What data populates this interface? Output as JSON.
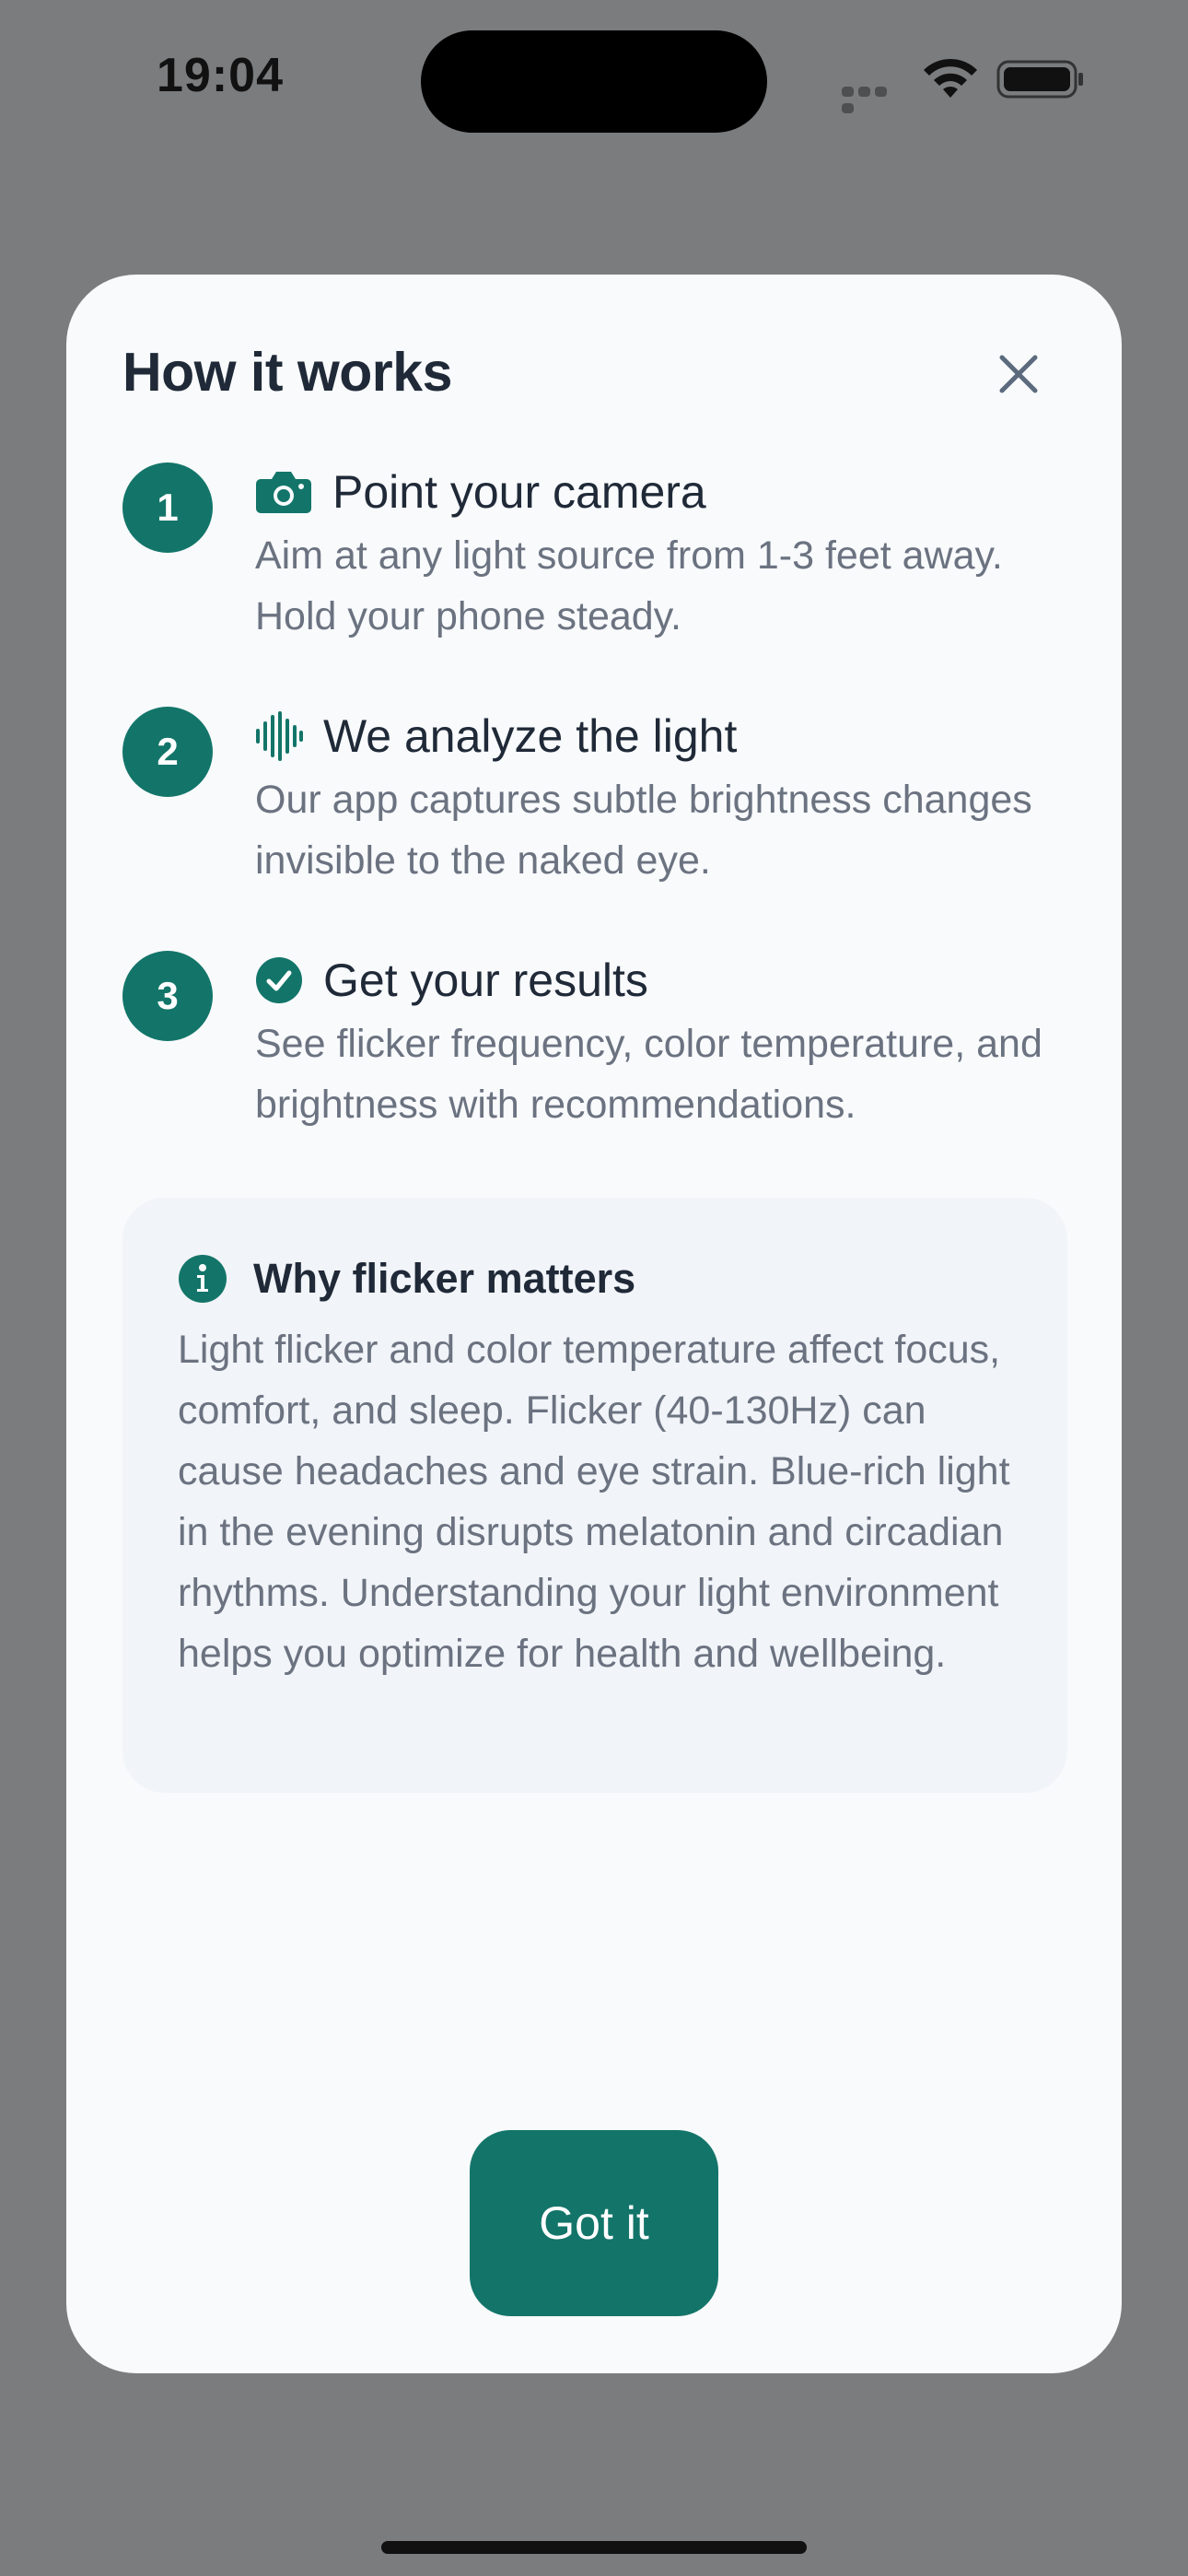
{
  "status_bar": {
    "time": "19:04",
    "icons": [
      "cellular-signal-icon",
      "wifi-icon",
      "battery-icon"
    ]
  },
  "sheet": {
    "title": "How it works",
    "close_icon": "close-icon",
    "steps": [
      {
        "number": "1",
        "icon": "camera-icon",
        "title": "Point your camera",
        "description": "Aim at any light source from 1-3 feet away. Hold your phone steady."
      },
      {
        "number": "2",
        "icon": "waveform-icon",
        "title": "We analyze the light",
        "description": "Our app captures subtle brightness changes invisible to the naked eye."
      },
      {
        "number": "3",
        "icon": "checkmark-circle-icon",
        "title": "Get your results",
        "description": "See flicker frequency, color temperature, and brightness with recommendations."
      }
    ],
    "info": {
      "icon": "info-icon",
      "title": "Why flicker matters",
      "text": "Light flicker and color temperature affect focus, comfort, and sleep. Flicker (40-130Hz) can cause headaches and eye strain. Blue-rich light in the evening disrupts melatonin and circadian rhythms. Understanding your light environment helps you optimize for health and wellbeing."
    },
    "primary_button": "Got it"
  },
  "colors": {
    "accent": "#137569",
    "backdrop": "#7b7c7e",
    "sheet_background": "#f8fafc",
    "info_background": "#f1f4f8",
    "title_text": "#1f2937",
    "body_text": "#6b7280"
  }
}
